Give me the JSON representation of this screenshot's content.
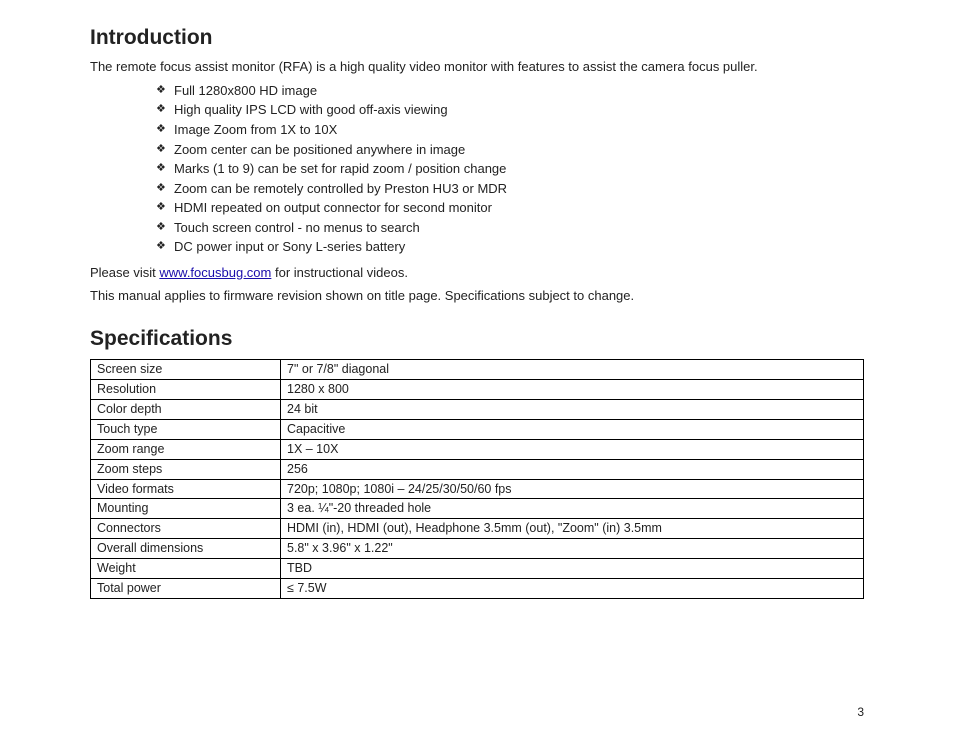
{
  "intro": {
    "heading": "Introduction",
    "p1": "The remote focus assist monitor (RFA) is a high quality video monitor with features to assist the camera focus puller.",
    "features": [
      "Full 1280x800 HD image",
      "High quality IPS LCD with good off-axis viewing",
      "Image Zoom from 1X to 10X",
      "Zoom center can be positioned anywhere in image",
      "Marks (1 to 9) can be set for rapid zoom / position change",
      "Zoom can be remotely controlled by Preston HU3 or MDR",
      "HDMI repeated on output connector for second monitor",
      "Touch screen control - no menus to search",
      "DC power input or Sony L-series battery"
    ],
    "p2_a": "Please visit ",
    "p2_link_text": "www.focusbug.com",
    "p2_b": " for instructional videos.",
    "p3": "This manual applies to firmware revision shown on title page. Specifications subject to change."
  },
  "spec": {
    "heading": "Specifications",
    "rows": [
      [
        "Screen size",
        "7\" or 7/8\" diagonal"
      ],
      [
        "Resolution",
        "1280 x 800"
      ],
      [
        "Color depth",
        "24 bit"
      ],
      [
        "Touch type",
        "Capacitive"
      ],
      [
        "Zoom range",
        "1X – 10X"
      ],
      [
        "Zoom steps",
        "256"
      ],
      [
        "Video formats",
        "720p; 1080p; 1080i – 24/25/30/50/60 fps"
      ],
      [
        "Mounting",
        "3 ea. ¼\"-20 threaded hole"
      ],
      [
        "Connectors",
        "HDMI (in), HDMI (out), Headphone 3.5mm (out), \"Zoom\" (in) 3.5mm"
      ],
      [
        "Overall dimensions",
        "5.8\" x 3.96\" x 1.22\""
      ],
      [
        "Weight",
        "TBD"
      ],
      [
        "Total power",
        "≤ 7.5W"
      ]
    ]
  },
  "page_number": "3"
}
